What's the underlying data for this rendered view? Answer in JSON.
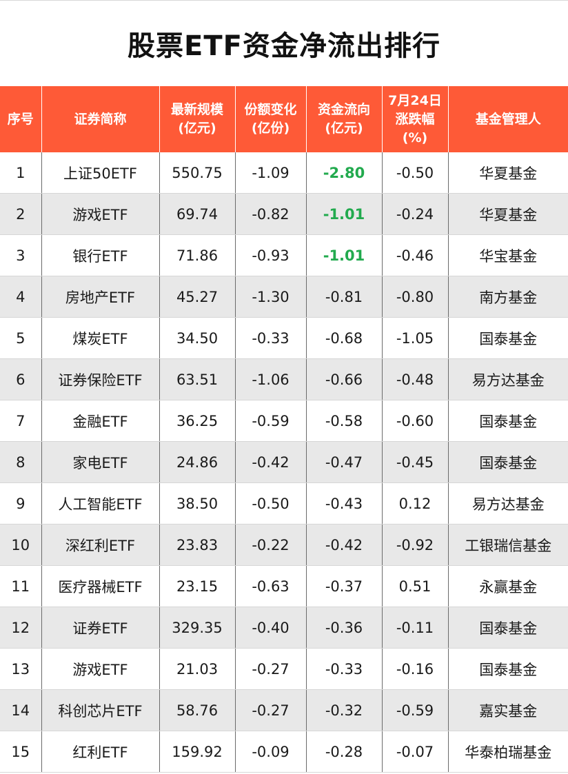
{
  "title": "股票ETF资金净流出排行",
  "colors": {
    "header_bg": "#fe5a37",
    "header_text": "#ffffff",
    "highlight_green": "#22aa4e",
    "stripe": "#e8e8e8"
  },
  "headers": [
    {
      "line1": "序号",
      "line2": "",
      "line3": ""
    },
    {
      "line1": "证券简称",
      "line2": "",
      "line3": ""
    },
    {
      "line1": "最新规模",
      "line2": "(亿元)",
      "line3": ""
    },
    {
      "line1": "份额变化",
      "line2": "(亿份)",
      "line3": ""
    },
    {
      "line1": "资金流向",
      "line2": "(亿元)",
      "line3": ""
    },
    {
      "line1": "7月24日",
      "line2": "涨跌幅",
      "line3": "(%)"
    },
    {
      "line1": "基金管理人",
      "line2": "",
      "line3": ""
    }
  ],
  "rows": [
    {
      "no": "1",
      "name": "上证50ETF",
      "size": "550.75",
      "share": "-1.09",
      "flow": "-2.80",
      "change": "-0.50",
      "manager": "华夏基金",
      "highlight": true
    },
    {
      "no": "2",
      "name": "游戏ETF",
      "size": "69.74",
      "share": "-0.82",
      "flow": "-1.01",
      "change": "-0.24",
      "manager": "华夏基金",
      "highlight": true
    },
    {
      "no": "3",
      "name": "银行ETF",
      "size": "71.86",
      "share": "-0.93",
      "flow": "-1.01",
      "change": "-0.46",
      "manager": "华宝基金",
      "highlight": true
    },
    {
      "no": "4",
      "name": "房地产ETF",
      "size": "45.27",
      "share": "-1.30",
      "flow": "-0.81",
      "change": "-0.80",
      "manager": "南方基金",
      "highlight": false
    },
    {
      "no": "5",
      "name": "煤炭ETF",
      "size": "34.50",
      "share": "-0.33",
      "flow": "-0.68",
      "change": "-1.05",
      "manager": "国泰基金",
      "highlight": false
    },
    {
      "no": "6",
      "name": "证券保险ETF",
      "size": "63.51",
      "share": "-1.06",
      "flow": "-0.66",
      "change": "-0.48",
      "manager": "易方达基金",
      "highlight": false
    },
    {
      "no": "7",
      "name": "金融ETF",
      "size": "36.25",
      "share": "-0.59",
      "flow": "-0.58",
      "change": "-0.60",
      "manager": "国泰基金",
      "highlight": false
    },
    {
      "no": "8",
      "name": "家电ETF",
      "size": "24.86",
      "share": "-0.42",
      "flow": "-0.47",
      "change": "-0.45",
      "manager": "国泰基金",
      "highlight": false
    },
    {
      "no": "9",
      "name": "人工智能ETF",
      "size": "38.50",
      "share": "-0.50",
      "flow": "-0.43",
      "change": "0.12",
      "manager": "易方达基金",
      "highlight": false
    },
    {
      "no": "10",
      "name": "深红利ETF",
      "size": "23.83",
      "share": "-0.22",
      "flow": "-0.42",
      "change": "-0.92",
      "manager": "工银瑞信基金",
      "highlight": false
    },
    {
      "no": "11",
      "name": "医疗器械ETF",
      "size": "23.15",
      "share": "-0.63",
      "flow": "-0.37",
      "change": "0.51",
      "manager": "永赢基金",
      "highlight": false
    },
    {
      "no": "12",
      "name": "证券ETF",
      "size": "329.35",
      "share": "-0.40",
      "flow": "-0.36",
      "change": "-0.11",
      "manager": "国泰基金",
      "highlight": false
    },
    {
      "no": "13",
      "name": "游戏ETF",
      "size": "21.03",
      "share": "-0.27",
      "flow": "-0.33",
      "change": "-0.16",
      "manager": "国泰基金",
      "highlight": false
    },
    {
      "no": "14",
      "name": "科创芯片ETF",
      "size": "58.76",
      "share": "-0.27",
      "flow": "-0.32",
      "change": "-0.59",
      "manager": "嘉实基金",
      "highlight": false
    },
    {
      "no": "15",
      "name": "红利ETF",
      "size": "159.92",
      "share": "-0.09",
      "flow": "-0.28",
      "change": "-0.07",
      "manager": "华泰柏瑞基金",
      "highlight": false
    }
  ]
}
